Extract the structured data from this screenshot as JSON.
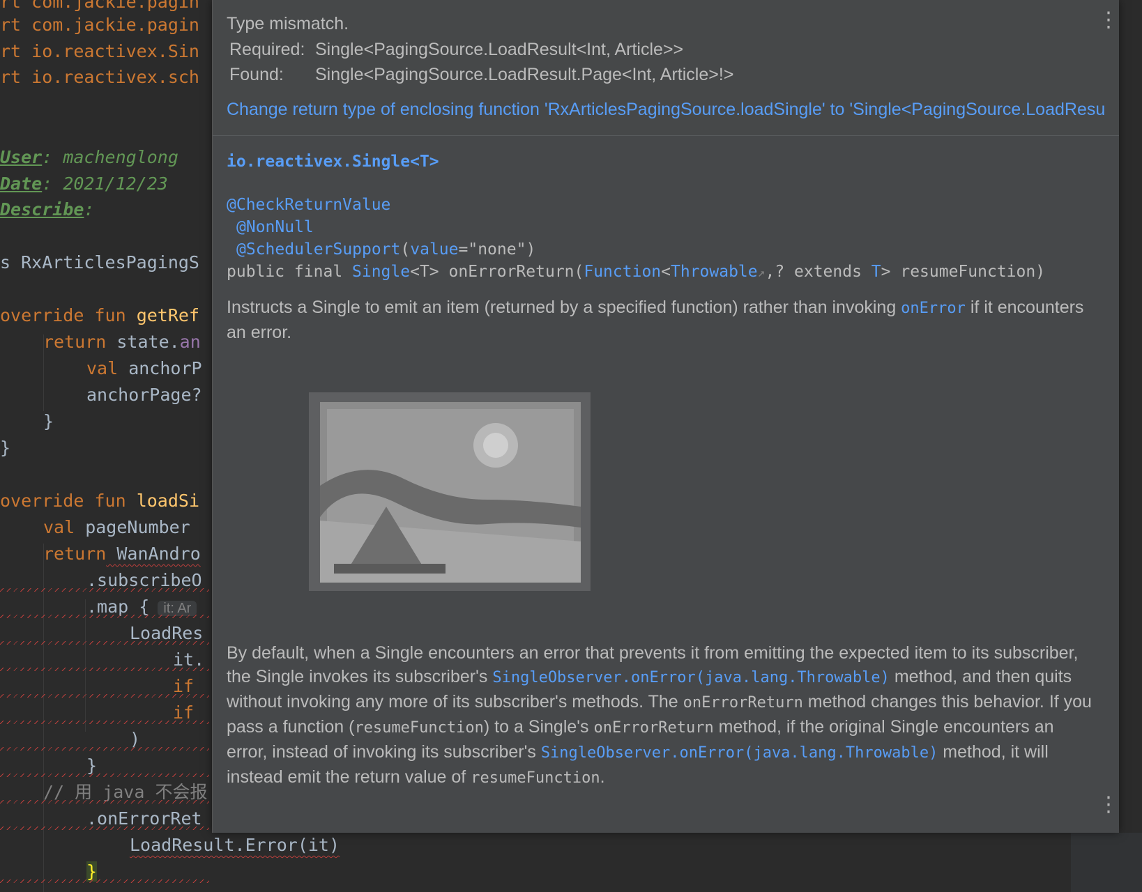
{
  "code": {
    "imports": [
      "rt com.jackie.pagin",
      "rt com.jackie.pagin",
      "rt io.reactivex.Sin",
      "rt io.reactivex.sch"
    ],
    "doc": {
      "user_tag": "User",
      "user_val": ": machenglong",
      "date_tag": "Date",
      "date_val": ": 2021/12/23",
      "desc_tag": "Describe",
      "desc_val": ":"
    },
    "class_line": "s RxArticlesPagingS",
    "l_override1": "override",
    "l_fun1": " fun ",
    "l_name1": "getRef",
    "l_return1": "return",
    "l_state": " state.",
    "l_an": "an",
    "l_val1": "val",
    "l_anchorP": " anchorP",
    "l_anchorPage": "anchorPage?",
    "l_close1": "}",
    "l_close2": "}",
    "l_override2": "override",
    "l_fun2": " fun ",
    "l_name2": "loadSi",
    "l_val2": "val",
    "l_pageNumber": " pageNumber",
    "l_return2": "return",
    "l_wan": " WanAndro",
    "l_subscribe": ".subscribeO",
    "l_map": ".map {",
    "l_map_hint": "it: Ar",
    "l_loadres": "LoadRes",
    "l_it": "it.",
    "l_if1": "if",
    "l_if2": "if",
    "l_paren": ")",
    "l_close3": "}",
    "l_comment": "// 用 java 不会报",
    "l_onerror": ".onErrorRet",
    "l_loaderr": "LoadResult.Error(it)",
    "l_close4": "}"
  },
  "popup": {
    "error_title": "Type mismatch.",
    "required_label": "Required:",
    "required_type": "Single<PagingSource.LoadResult<Int, Article>>",
    "found_label": "Found:",
    "found_type": "Single<PagingSource.LoadResult.Page<Int, Article>!>",
    "quickfix": "Change return type of enclosing function 'RxArticlesPagingSource.loadSingle' to 'Single<PagingSource.LoadResu",
    "doc": {
      "class_name": "io.reactivex.Single<T>",
      "ann1": "@CheckReturnValue",
      "ann2": "@NonNull",
      "ann3_name": "@SchedulerSupport",
      "ann3_open": "(",
      "ann3_key": "value",
      "ann3_rest": "=\"none\")",
      "sig_pre": "public final ",
      "sig_single": "Single",
      "sig_t1": "<T> onErrorReturn(",
      "sig_function": "Function",
      "sig_lt": "<",
      "sig_throwable": "Throwable",
      "sig_arrow": "↗",
      "sig_extends": ",? extends ",
      "sig_T": "T",
      "sig_end": "> resumeFunction)",
      "p1_a": "Instructs a Single to emit an item (returned by a specified function) rather than invoking ",
      "p1_link": "onError",
      "p1_b": " if it encounters an error.",
      "p2_a": "By default, when a Single encounters an error that prevents it from emitting the expected item to its subscriber, the Single invokes its subscriber's ",
      "p2_link1": "SingleObserver.onError(java.lang.Throwable)",
      "p2_b": " method, and then quits without invoking any more of its subscriber's methods. The ",
      "p2_code1": "onErrorReturn",
      "p2_c": " method changes this behavior. If you pass a function (",
      "p2_code2": "resumeFunction",
      "p2_d": ") to a Single's ",
      "p2_code3": "onErrorReturn",
      "p2_e": " method, if the original Single encounters an error, instead of invoking its subscriber's ",
      "p2_link2": "SingleObserver.onError(java.lang.Throwable)",
      "p2_f": " method, it will instead emit the return value of ",
      "p2_code4": "resumeFunction",
      "p2_g": "."
    },
    "menu_icon": "⋮"
  }
}
